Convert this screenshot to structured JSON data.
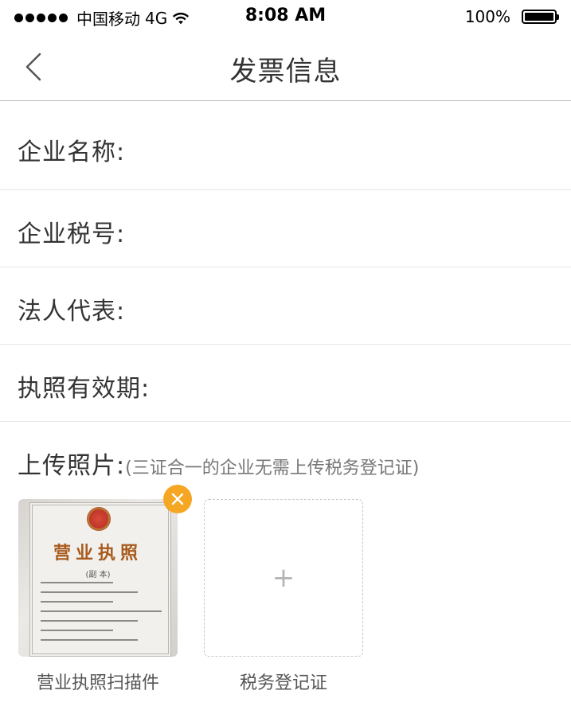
{
  "status_bar": {
    "carrier": "中国移动",
    "network": "4G",
    "time": "8:08 AM",
    "battery": "100%",
    "icons": [
      "signal-dots-icon",
      "wifi-icon",
      "battery-icon"
    ]
  },
  "nav": {
    "title": "发票信息",
    "back_icon": "chevron-left-icon"
  },
  "form": {
    "fields": [
      {
        "label": "企业名称:",
        "value": "",
        "placeholder": ""
      },
      {
        "label": "企业税号:",
        "value": "",
        "placeholder": ""
      },
      {
        "label": "法人代表:",
        "value": "",
        "placeholder": ""
      },
      {
        "label": "执照有效期:",
        "value": "",
        "placeholder": ""
      }
    ]
  },
  "upload": {
    "title": "上传照片:",
    "note": "(三证合一的企业无需上传税务登记证)",
    "items": [
      {
        "caption": "营业执照扫描件",
        "image": {
          "heading": "营业执照",
          "sub": "(副 本)"
        },
        "remove_icon": "close-icon"
      },
      {
        "caption": "税务登记证",
        "add_icon": "plus-icon"
      }
    ]
  },
  "colors": {
    "accent": "#f5a623",
    "divider": "#e6e6e6",
    "text": "#333333"
  }
}
